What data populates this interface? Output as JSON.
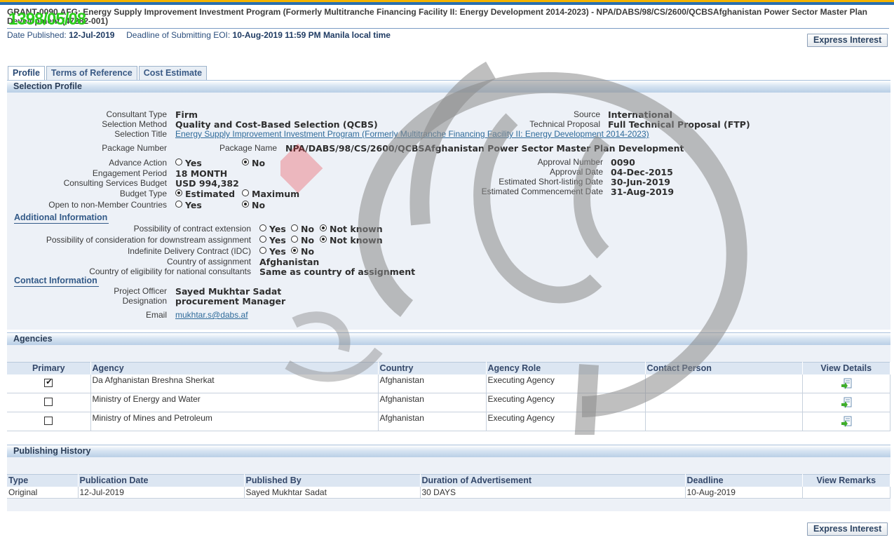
{
  "header": {
    "title": "GRANT-0090 AFG: Energy Supply Improvement Investment Program (Formerly Multitranche Financing Facility II: Energy Development 2014-2023) - NPA/DABS/98/CS/2600/QCBSAfghanistan Power Sector Master Plan Development (47282-001)",
    "stamp": "1398/05/08",
    "published_label": "Date Published:",
    "published_value": "12-Jul-2019",
    "deadline_label": "Deadline of Submitting EOI:",
    "deadline_value": "10-Aug-2019 11:59 PM Manila local time",
    "express_interest": "Express Interest"
  },
  "tabs": [
    "Profile",
    "Terms of Reference",
    "Cost Estimate"
  ],
  "selection_profile": {
    "heading": "Selection Profile",
    "consultant_type_label": "Consultant Type",
    "consultant_type": "Firm",
    "selection_method_label": "Selection Method",
    "selection_method": "Quality and Cost-Based Selection (QCBS)",
    "selection_title_label": "Selection Title",
    "selection_title": "Energy Supply Improvement Investment Program (Formerly Multitranche Financing Facility II: Energy Development 2014-2023)",
    "package_number_label": "Package Number",
    "package_name_label": "Package Name",
    "package_name": "NPA/DABS/98/CS/2600/QCBSAfghanistan Power Sector Master Plan Development",
    "advance_action_label": "Advance Action",
    "engagement_period_label": "Engagement Period",
    "engagement_period": "18 MONTH",
    "budget_label": "Consulting Services Budget",
    "budget": "USD 994,382",
    "budget_type_label": "Budget Type",
    "estimated": "Estimated",
    "maximum": "Maximum",
    "open_label": "Open to non-Member Countries",
    "yes": "Yes",
    "no": "No",
    "not_known": "Not known",
    "source_label": "Source",
    "source": "International",
    "technical_proposal_label": "Technical Proposal",
    "technical_proposal": "Full Technical Proposal (FTP)",
    "approval_number_label": "Approval Number",
    "approval_number": "0090",
    "approval_date_label": "Approval Date",
    "approval_date": "04-Dec-2015",
    "shortlisting_label": "Estimated Short-listing Date",
    "shortlisting": "30-Jun-2019",
    "commencement_label": "Estimated Commencement Date",
    "commencement": "31-Aug-2019",
    "additional_info": "Additional Information",
    "extension_label": "Possibility of contract extension",
    "downstream_label": "Possibility of consideration for downstream assignment",
    "idc_label": "Indefinite Delivery Contract (IDC)",
    "country_label": "Country of assignment",
    "country": "Afghanistan",
    "eligibility_label": "Country of eligibility for national consultants",
    "eligibility": "Same as country of assignment",
    "contact_info": "Contact Information",
    "officer_label": "Project Officer",
    "officer": "Sayed Mukhtar Sadat",
    "designation_label": "Designation",
    "designation": "procurement Manager",
    "email_label": "Email",
    "email": "mukhtar.s@dabs.af"
  },
  "agencies": {
    "heading": "Agencies",
    "columns": [
      "Primary",
      "Agency",
      "Country",
      "Agency Role",
      "Contact Person",
      "View Details"
    ],
    "rows": [
      {
        "primary": true,
        "agency": "Da Afghanistan Breshna Sherkat",
        "country": "Afghanistan",
        "role": "Executing Agency",
        "contact": ""
      },
      {
        "primary": false,
        "agency": "Ministry of Energy and Water",
        "country": "Afghanistan",
        "role": "Executing Agency",
        "contact": ""
      },
      {
        "primary": false,
        "agency": "Ministry of Mines and Petroleum",
        "country": "Afghanistan",
        "role": "Executing Agency",
        "contact": ""
      }
    ]
  },
  "publishing": {
    "heading": "Publishing History",
    "columns": [
      "Type",
      "Publication Date",
      "Published By",
      "Duration of Advertisement",
      "Deadline",
      "View Remarks"
    ],
    "rows": [
      {
        "type": "Original",
        "date": "12-Jul-2019",
        "by": "Sayed Mukhtar Sadat",
        "duration": "30 DAYS",
        "deadline": "10-Aug-2019",
        "remarks": ""
      }
    ]
  },
  "colors": {
    "accent": "#2a6fb0",
    "link": "#2e6a9a",
    "stamp": "#2bcf1b"
  }
}
